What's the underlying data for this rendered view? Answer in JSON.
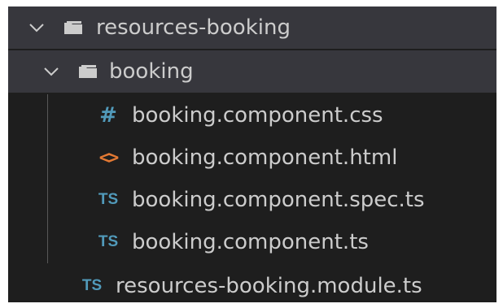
{
  "explorer": {
    "root_folder": {
      "label": "resources-booking",
      "chevron_icon": "chevron-down-icon",
      "folder_icon": "folder-open-icon"
    },
    "subfolder": {
      "label": "booking",
      "chevron_icon": "chevron-down-icon",
      "folder_icon": "folder-open-icon"
    },
    "files": [
      {
        "label": "booking.component.css",
        "icon": "css-file-icon",
        "glyph": "#",
        "color": "#519aba"
      },
      {
        "label": "booking.component.html",
        "icon": "html-file-icon",
        "glyph": "<>",
        "color": "#e37933"
      },
      {
        "label": "booking.component.spec.ts",
        "icon": "ts-file-icon",
        "glyph": "TS",
        "color": "#519aba"
      },
      {
        "label": "booking.component.ts",
        "icon": "ts-file-icon",
        "glyph": "TS",
        "color": "#519aba"
      }
    ],
    "root_files": [
      {
        "label": "resources-booking.module.ts",
        "icon": "ts-file-icon",
        "glyph": "TS",
        "color": "#519aba"
      }
    ]
  },
  "colors": {
    "background": "#1e1e1e",
    "selected_row": "#37373d",
    "text": "#cccccc"
  }
}
